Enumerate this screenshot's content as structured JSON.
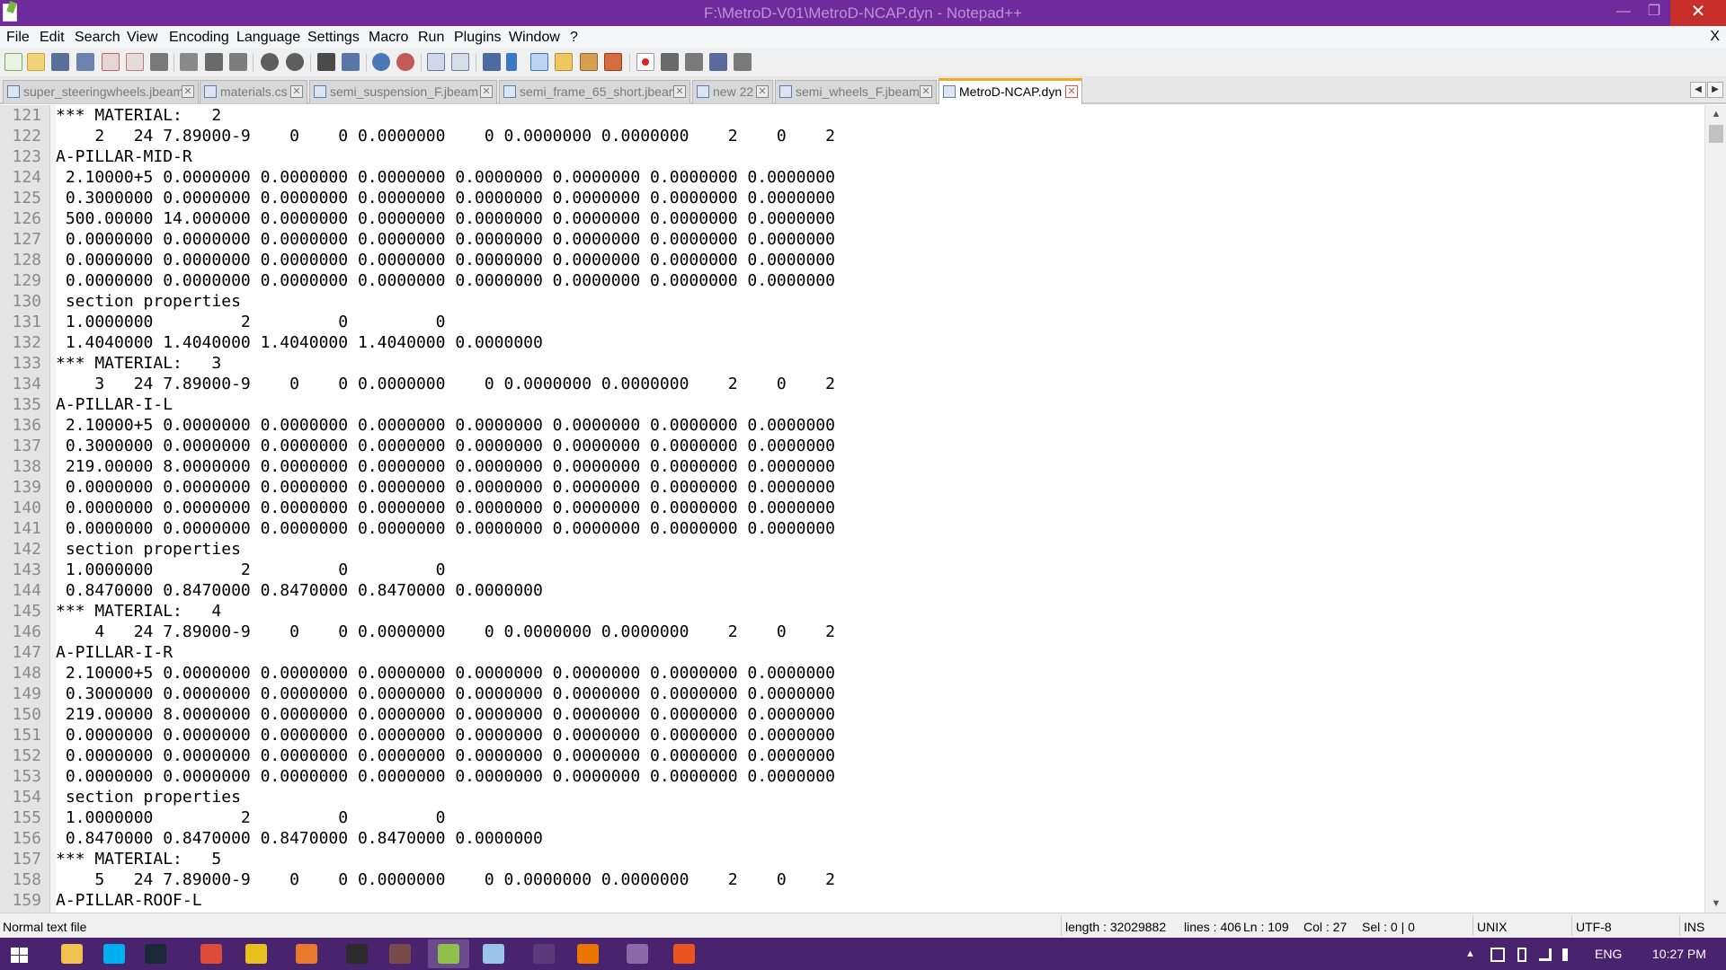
{
  "window": {
    "title": "F:\\MetroD-V01\\MetroD-NCAP.dyn - Notepad++",
    "icon": "notepad-plus-plus-icon",
    "minimize_glyph": "—",
    "maximize_glyph": "❐",
    "close_glyph": "✕"
  },
  "menu": {
    "items": [
      "File",
      "Edit",
      "Search",
      "View",
      "Encoding",
      "Language",
      "Settings",
      "Macro",
      "Run",
      "Plugins",
      "Window",
      "?"
    ],
    "doc_close": "X"
  },
  "tabs": [
    {
      "label": "super_steeringwheels.jbeam",
      "active": false
    },
    {
      "label": "materials.cs",
      "active": false
    },
    {
      "label": "semi_suspension_F.jbeam",
      "active": false
    },
    {
      "label": "semi_frame_65_short.jbeam",
      "active": false
    },
    {
      "label": "new 22",
      "active": false
    },
    {
      "label": "semi_wheels_F.jbeam",
      "active": false
    },
    {
      "label": "MetroD-NCAP.dyn",
      "active": true
    }
  ],
  "tab_close_glyph": "✕",
  "tab_scroll": {
    "left": "◀",
    "right": "▶"
  },
  "editor": {
    "lines": [
      {
        "n": "121",
        "t": "*** MATERIAL:   2"
      },
      {
        "n": "122",
        "t": "    2   24 7.89000-9    0    0 0.0000000    0 0.0000000 0.0000000    2    0    2"
      },
      {
        "n": "123",
        "t": "A-PILLAR-MID-R"
      },
      {
        "n": "124",
        "t": " 2.10000+5 0.0000000 0.0000000 0.0000000 0.0000000 0.0000000 0.0000000 0.0000000"
      },
      {
        "n": "125",
        "t": " 0.3000000 0.0000000 0.0000000 0.0000000 0.0000000 0.0000000 0.0000000 0.0000000"
      },
      {
        "n": "126",
        "t": " 500.00000 14.000000 0.0000000 0.0000000 0.0000000 0.0000000 0.0000000 0.0000000"
      },
      {
        "n": "127",
        "t": " 0.0000000 0.0000000 0.0000000 0.0000000 0.0000000 0.0000000 0.0000000 0.0000000"
      },
      {
        "n": "128",
        "t": " 0.0000000 0.0000000 0.0000000 0.0000000 0.0000000 0.0000000 0.0000000 0.0000000"
      },
      {
        "n": "129",
        "t": " 0.0000000 0.0000000 0.0000000 0.0000000 0.0000000 0.0000000 0.0000000 0.0000000"
      },
      {
        "n": "130",
        "t": " section properties"
      },
      {
        "n": "131",
        "t": " 1.0000000         2         0         0"
      },
      {
        "n": "132",
        "t": " 1.4040000 1.4040000 1.4040000 1.4040000 0.0000000"
      },
      {
        "n": "133",
        "t": "*** MATERIAL:   3"
      },
      {
        "n": "134",
        "t": "    3   24 7.89000-9    0    0 0.0000000    0 0.0000000 0.0000000    2    0    2"
      },
      {
        "n": "135",
        "t": "A-PILLAR-I-L"
      },
      {
        "n": "136",
        "t": " 2.10000+5 0.0000000 0.0000000 0.0000000 0.0000000 0.0000000 0.0000000 0.0000000"
      },
      {
        "n": "137",
        "t": " 0.3000000 0.0000000 0.0000000 0.0000000 0.0000000 0.0000000 0.0000000 0.0000000"
      },
      {
        "n": "138",
        "t": " 219.00000 8.0000000 0.0000000 0.0000000 0.0000000 0.0000000 0.0000000 0.0000000"
      },
      {
        "n": "139",
        "t": " 0.0000000 0.0000000 0.0000000 0.0000000 0.0000000 0.0000000 0.0000000 0.0000000"
      },
      {
        "n": "140",
        "t": " 0.0000000 0.0000000 0.0000000 0.0000000 0.0000000 0.0000000 0.0000000 0.0000000"
      },
      {
        "n": "141",
        "t": " 0.0000000 0.0000000 0.0000000 0.0000000 0.0000000 0.0000000 0.0000000 0.0000000"
      },
      {
        "n": "142",
        "t": " section properties"
      },
      {
        "n": "143",
        "t": " 1.0000000         2         0         0"
      },
      {
        "n": "144",
        "t": " 0.8470000 0.8470000 0.8470000 0.8470000 0.0000000"
      },
      {
        "n": "145",
        "t": "*** MATERIAL:   4"
      },
      {
        "n": "146",
        "t": "    4   24 7.89000-9    0    0 0.0000000    0 0.0000000 0.0000000    2    0    2"
      },
      {
        "n": "147",
        "t": "A-PILLAR-I-R"
      },
      {
        "n": "148",
        "t": " 2.10000+5 0.0000000 0.0000000 0.0000000 0.0000000 0.0000000 0.0000000 0.0000000"
      },
      {
        "n": "149",
        "t": " 0.3000000 0.0000000 0.0000000 0.0000000 0.0000000 0.0000000 0.0000000 0.0000000"
      },
      {
        "n": "150",
        "t": " 219.00000 8.0000000 0.0000000 0.0000000 0.0000000 0.0000000 0.0000000 0.0000000"
      },
      {
        "n": "151",
        "t": " 0.0000000 0.0000000 0.0000000 0.0000000 0.0000000 0.0000000 0.0000000 0.0000000"
      },
      {
        "n": "152",
        "t": " 0.0000000 0.0000000 0.0000000 0.0000000 0.0000000 0.0000000 0.0000000 0.0000000"
      },
      {
        "n": "153",
        "t": " 0.0000000 0.0000000 0.0000000 0.0000000 0.0000000 0.0000000 0.0000000 0.0000000"
      },
      {
        "n": "154",
        "t": " section properties"
      },
      {
        "n": "155",
        "t": " 1.0000000         2         0         0"
      },
      {
        "n": "156",
        "t": " 0.8470000 0.8470000 0.8470000 0.8470000 0.0000000"
      },
      {
        "n": "157",
        "t": "*** MATERIAL:   5"
      },
      {
        "n": "158",
        "t": "    5   24 7.89000-9    0    0 0.0000000    0 0.0000000 0.0000000    2    0    2"
      },
      {
        "n": "159",
        "t": "A-PILLAR-ROOF-L"
      }
    ]
  },
  "scrollbar": {
    "up": "▲",
    "down": "▼"
  },
  "status": {
    "file_type": "Normal text file",
    "length": "length : 32029882",
    "lines": "lines : 406",
    "ln": "Ln : 109",
    "col": "Col : 27",
    "sel": "Sel : 0 | 0",
    "eol": "UNIX",
    "encoding": "UTF-8",
    "mode": "INS"
  },
  "taskbar": {
    "apps": [
      {
        "name": "start-button",
        "icon": "windows-logo-icon",
        "color": "#ffffff"
      },
      {
        "name": "file-explorer",
        "icon": "folder-icon",
        "color": "#f2c14e"
      },
      {
        "name": "skype",
        "icon": "skype-icon",
        "color": "#00aff0"
      },
      {
        "name": "steam",
        "icon": "steam-icon",
        "color": "#1b2838"
      },
      {
        "name": "chrome",
        "icon": "chrome-icon",
        "color": "#dd4b39"
      },
      {
        "name": "app-yellow",
        "icon": "tool-icon",
        "color": "#e8c11d"
      },
      {
        "name": "media-player",
        "icon": "media-player-icon",
        "color": "#e97a2b"
      },
      {
        "name": "terminal",
        "icon": "terminal-icon",
        "color": "#2b2b2b"
      },
      {
        "name": "game-app",
        "icon": "game-icon",
        "color": "#7a4a4a"
      },
      {
        "name": "notepad-plus-plus",
        "icon": "notepad-plus-plus-icon",
        "color": "#8fc04a"
      },
      {
        "name": "paint-app",
        "icon": "paint-icon",
        "color": "#9bc4e8"
      },
      {
        "name": "video-app",
        "icon": "film-icon",
        "color": "#5a3a7a"
      },
      {
        "name": "blender",
        "icon": "blender-icon",
        "color": "#ea7600"
      },
      {
        "name": "cad-app",
        "icon": "cad-icon",
        "color": "#8a6aa8"
      },
      {
        "name": "ubuntu-app",
        "icon": "ubuntu-icon",
        "color": "#e95420"
      }
    ],
    "active_app": "notepad-plus-plus",
    "tray": {
      "chevron": "▲",
      "lang": "ENG",
      "time": "10:27 PM"
    }
  }
}
